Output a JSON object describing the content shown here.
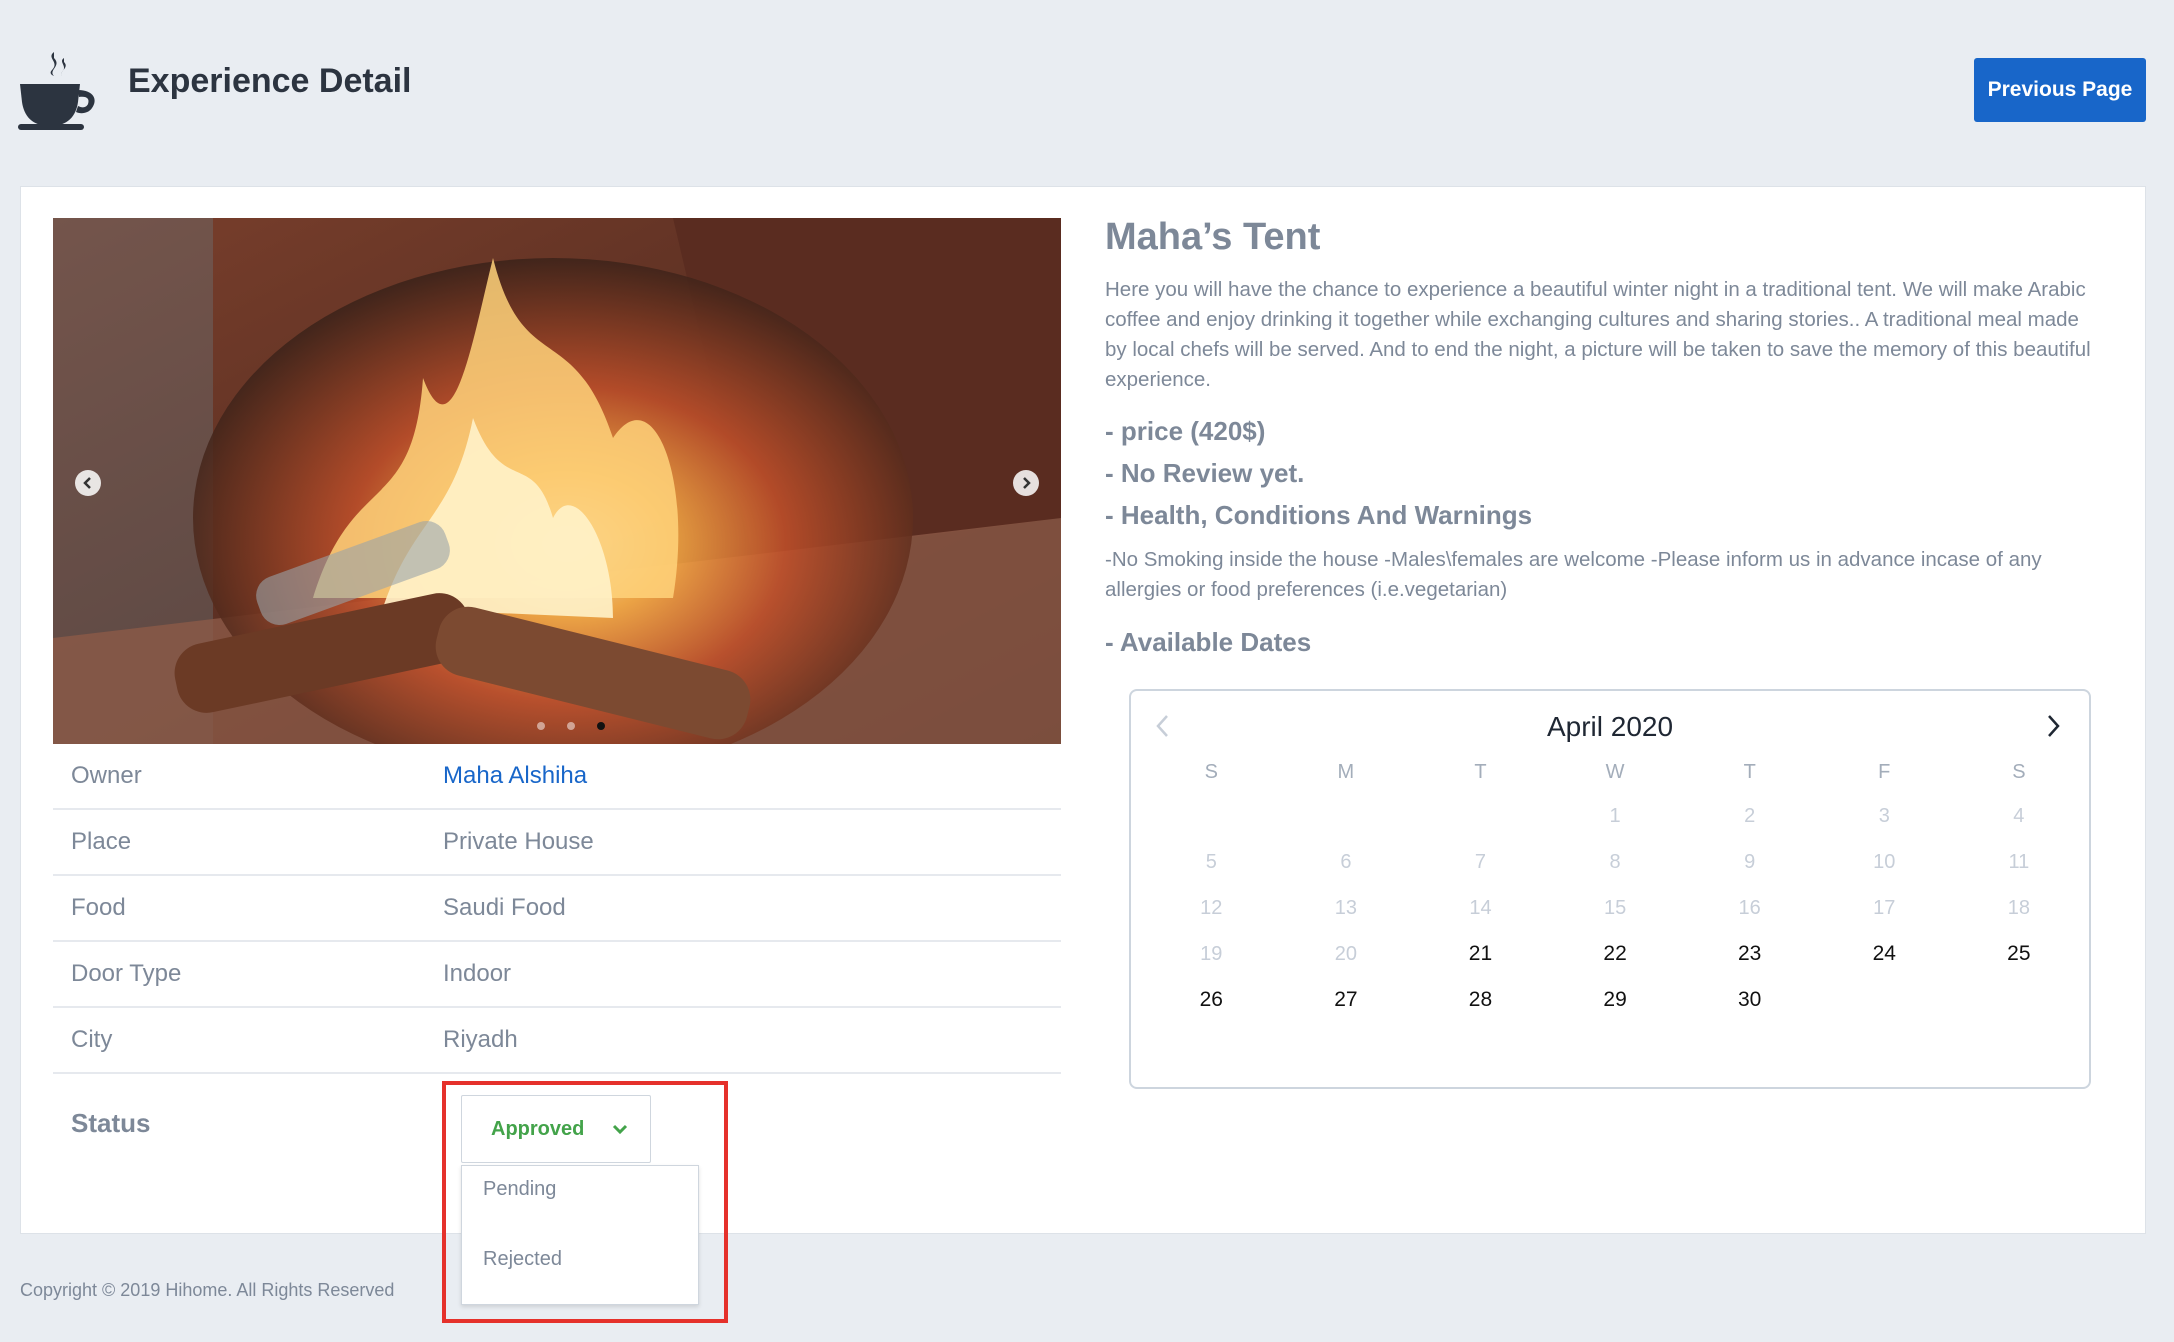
{
  "header": {
    "title": "Experience Detail",
    "previous_label": "Previous Page",
    "logo_icon": "coffee-cup-icon"
  },
  "carousel": {
    "prev_icon": "chevron-left-icon",
    "next_icon": "chevron-right-icon",
    "slide_count": 3,
    "active_slide": 3
  },
  "details": {
    "owner_label": "Owner",
    "owner_value": "Maha Alshiha",
    "place_label": "Place",
    "place_value": "Private House",
    "food_label": "Food",
    "food_value": "Saudi Food",
    "door_label": "Door Type",
    "door_value": "Indoor",
    "city_label": "City",
    "city_value": "Riyadh"
  },
  "status": {
    "label": "Status",
    "selected": "Approved",
    "options": [
      "Pending",
      "Rejected"
    ],
    "selected_color": "#43a34a"
  },
  "experience": {
    "title": "Maha’s Tent",
    "description": "Here you will have the chance to experience a beautiful winter night in a traditional tent. We will make Arabic coffee and enjoy drinking it together while exchanging cultures and sharing stories.. A traditional meal made by local chefs will be served. And to end the night, a picture will be taken to save the memory of this beautiful experience.",
    "price": "- price (420$)",
    "review": "- No Review yet.",
    "conditions_heading": "- Health, Conditions And Warnings",
    "conditions_text": "-No Smoking inside the house -Males\\females are welcome -Please inform us in advance incase of any allergies or food preferences (i.e.vegetarian)",
    "dates_heading": "- Available Dates"
  },
  "calendar": {
    "month": "April 2020",
    "weekdays": [
      "S",
      "M",
      "T",
      "W",
      "T",
      "F",
      "S"
    ],
    "weeks": [
      [
        "",
        "",
        "",
        "1",
        "2",
        "3",
        "4"
      ],
      [
        "5",
        "6",
        "7",
        "8",
        "9",
        "10",
        "11"
      ],
      [
        "12",
        "13",
        "14",
        "15",
        "16",
        "17",
        "18"
      ],
      [
        "19",
        "20",
        "21",
        "22",
        "23",
        "24",
        "25"
      ],
      [
        "26",
        "27",
        "28",
        "29",
        "30",
        "",
        ""
      ]
    ],
    "available": [
      "21",
      "22",
      "23",
      "24",
      "25",
      "26",
      "27",
      "28",
      "29",
      "30"
    ]
  },
  "footer": {
    "copyright": "Copyright © 2019 Hihome. All Rights Reserved"
  },
  "colors": {
    "primary": "#1866c9",
    "background": "#e9edf2",
    "highlight": "#e5312b"
  }
}
